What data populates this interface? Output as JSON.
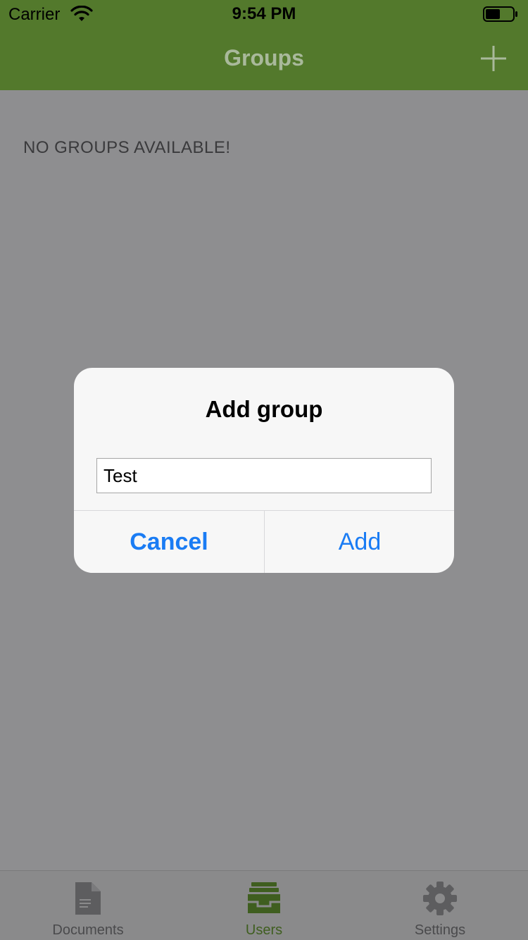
{
  "status_bar": {
    "carrier": "Carrier",
    "time": "9:54 PM"
  },
  "nav": {
    "title": "Groups",
    "add_icon": "plus-icon"
  },
  "content": {
    "empty_message": "NO GROUPS AVAILABLE!"
  },
  "dialog": {
    "title": "Add group",
    "input_value": "Test",
    "cancel_label": "Cancel",
    "add_label": "Add"
  },
  "tabbar": {
    "tabs": [
      {
        "label": "Documents",
        "icon": "document-icon",
        "active": false
      },
      {
        "label": "Users",
        "icon": "inbox-tray-icon",
        "active": true
      },
      {
        "label": "Settings",
        "icon": "gear-icon",
        "active": false
      }
    ]
  },
  "colors": {
    "nav_green": "#53792c",
    "dim_overlay_bg": "#8e8e90",
    "ios_blue": "#1a7cf4",
    "active_tab": "#3f5e1f"
  }
}
